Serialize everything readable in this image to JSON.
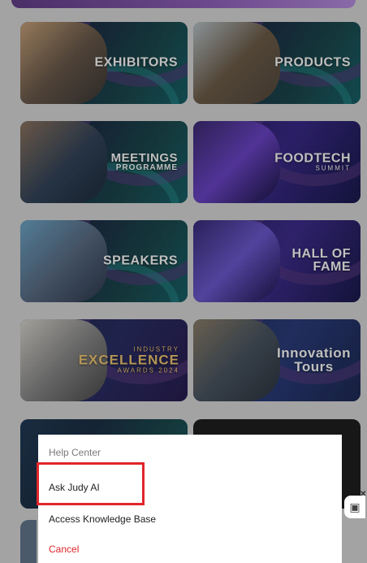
{
  "tiles": [
    {
      "label": "EXHIBITORS"
    },
    {
      "label": "PRODUCTS"
    },
    {
      "label": "MEETINGS",
      "sub": "PROGRAMME"
    },
    {
      "label": "FOODTECH",
      "sub": "SUMMIT"
    },
    {
      "label": "SPEAKERS"
    },
    {
      "label": "HALL OF",
      "sub": "FAME"
    },
    {
      "label": "INDUSTRY",
      "sub": "EXCELLENCE",
      "tiny": "AWARDS 2024"
    },
    {
      "label": "Innovation",
      "sub": "Tours"
    }
  ],
  "help_sheet": {
    "title": "Help Center",
    "items": [
      "Ask Judy AI",
      "Access Knowledge Base"
    ],
    "cancel": "Cancel"
  },
  "colors": {
    "highlight": "#e0262b",
    "cancel": "#e0262b"
  }
}
